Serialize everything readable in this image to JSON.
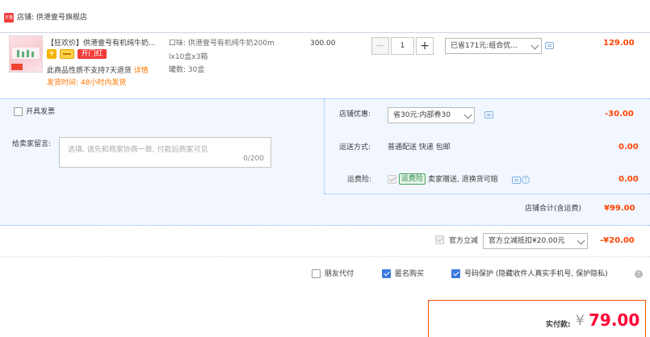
{
  "shop": {
    "badge_text": "天猫",
    "name": "店铺: 供港壹号旗舰店"
  },
  "item": {
    "title": "【狂欢价】供港壹号有机纯牛奶...",
    "badge_gold": "¥",
    "badge_red": "开门红",
    "no_return_text": "此商品性质不支持7天退货",
    "details_link": "详情",
    "ship_time": "发货时间: 48小时内发货",
    "spec_line1": "口味: 供港壹号有机纯牛奶200m",
    "spec_line2": "lx10盒x3箱",
    "spec_line3": "罐数: 30盒",
    "unit_price": "300.00",
    "qty_minus": "−",
    "qty_value": "1",
    "qty_plus": "+",
    "promo_select": "已省171元:组合优...",
    "subtotal": "129.00"
  },
  "invoice": {
    "label": "开具发票"
  },
  "note": {
    "label": "给卖家留言:",
    "placeholder": "选填, 请先和商家协商一致, 付款后商家可见",
    "counter": "0/200"
  },
  "shop_discount": {
    "label": "店铺优惠:",
    "select": "省30元:内部券30",
    "amount": "-30.00"
  },
  "shipping": {
    "label": "运送方式:",
    "value": "普通配送 快递 包邮",
    "amount": "0.00"
  },
  "insurance": {
    "label": "运费险:",
    "tag": "运费险",
    "text": "卖家赠送, 退换货可赔",
    "amount": "0.00"
  },
  "shop_total": {
    "label": "店铺合计(含运费)",
    "amount": "¥99.00"
  },
  "official_discount": {
    "label": "官方立减",
    "select": "官方立减抵扣¥20.00元",
    "amount": "-¥20.00"
  },
  "options": {
    "friend_pay": "朋友代付",
    "anonymous": "匿名购买",
    "privacy": "号码保护 (隐藏收件人真实手机号, 保护隐私)",
    "help_glyph": "?"
  },
  "payment": {
    "label": "实付款:",
    "currency": "¥",
    "amount": "79.00"
  },
  "colors": {
    "accent_red": "#ff4400",
    "panel_bg": "#f2f7ff",
    "check_blue": "#3b7be0",
    "orange": "#ff7700"
  }
}
